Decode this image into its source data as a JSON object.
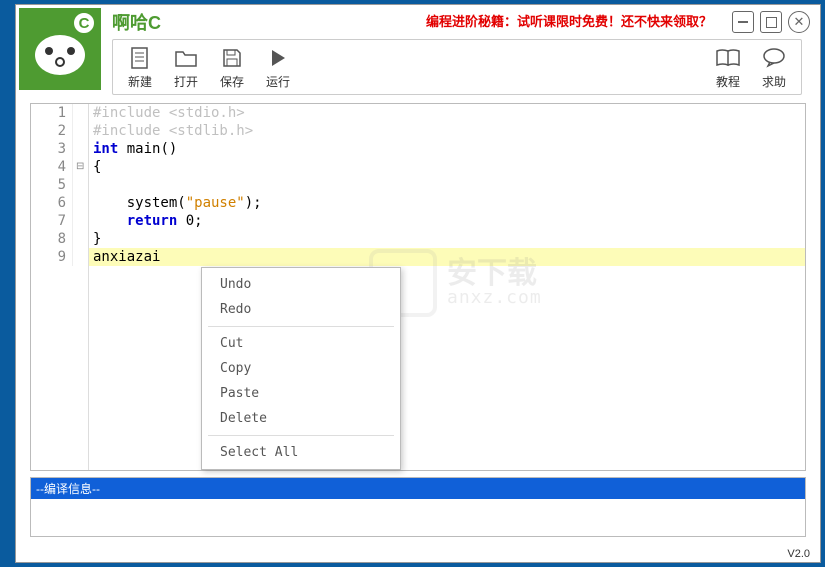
{
  "app": {
    "title": "啊哈C",
    "version": "V2.0"
  },
  "promo": "编程进阶秘籍：试听课限时免费！还不快来领取？",
  "toolbar": {
    "new": "新建",
    "open": "打开",
    "save": "保存",
    "run": "运行",
    "tutorial": "教程",
    "help": "求助"
  },
  "code": {
    "lines": [
      {
        "n": 1,
        "segs": [
          {
            "t": "#include <stdio.h>",
            "c": "kw-pp"
          }
        ]
      },
      {
        "n": 2,
        "segs": [
          {
            "t": "#include <stdlib.h>",
            "c": "kw-pp"
          }
        ]
      },
      {
        "n": 3,
        "segs": [
          {
            "t": "int",
            "c": "kw-blue"
          },
          {
            "t": " main()",
            "c": ""
          }
        ]
      },
      {
        "n": 4,
        "segs": [
          {
            "t": "{",
            "c": ""
          }
        ],
        "fold": true
      },
      {
        "n": 5,
        "segs": []
      },
      {
        "n": 6,
        "segs": [
          {
            "t": "    system(",
            "c": ""
          },
          {
            "t": "\"pause\"",
            "c": "kw-str-q"
          },
          {
            "t": ");",
            "c": ""
          }
        ]
      },
      {
        "n": 7,
        "segs": [
          {
            "t": "    ",
            "c": ""
          },
          {
            "t": "return",
            "c": "kw-blue"
          },
          {
            "t": " 0;",
            "c": ""
          }
        ]
      },
      {
        "n": 8,
        "segs": [
          {
            "t": "}",
            "c": ""
          }
        ]
      },
      {
        "n": 9,
        "segs": [
          {
            "t": "anxiazai",
            "c": ""
          }
        ],
        "hl": true
      }
    ]
  },
  "contextMenu": {
    "undo": "Undo",
    "redo": "Redo",
    "cut": "Cut",
    "copy": "Copy",
    "paste": "Paste",
    "delete": "Delete",
    "selectAll": "Select All"
  },
  "watermark": {
    "cn": "安下载",
    "en": "anxz.com"
  },
  "output": {
    "title": "--编译信息--"
  }
}
